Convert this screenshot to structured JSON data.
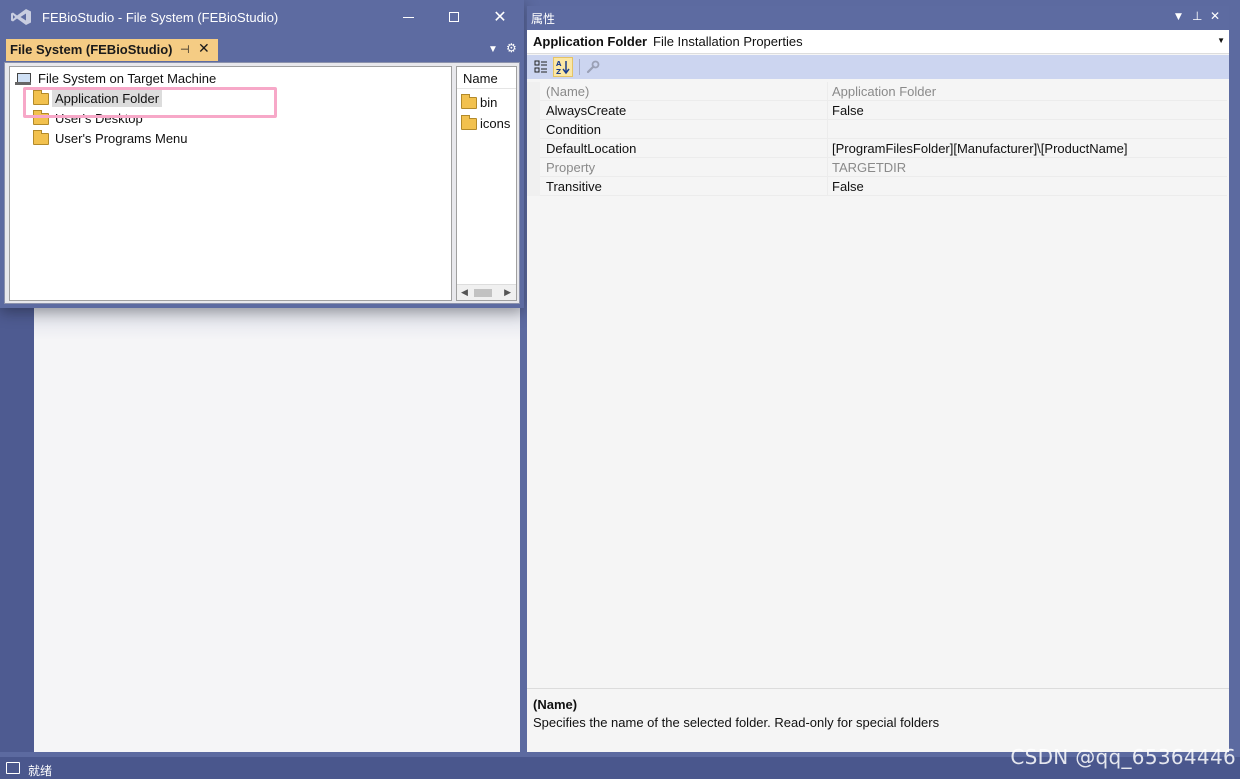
{
  "window": {
    "title": "FEBioStudio - File System (FEBioStudio)"
  },
  "doc_tab": {
    "label": "File System (FEBioStudio)",
    "pin_glyph": "⊣",
    "close_glyph": "✕"
  },
  "tree": {
    "root": "File System on Target Machine",
    "items": [
      {
        "label": "Application Folder",
        "selected": true
      },
      {
        "label": "User's Desktop",
        "selected": false
      },
      {
        "label": "User's Programs Menu",
        "selected": false
      }
    ]
  },
  "file_list": {
    "header": "Name",
    "items": [
      "bin",
      "icons"
    ]
  },
  "properties": {
    "title": "属性",
    "object_name": "Application Folder",
    "object_type": "File Installation Properties",
    "rows": [
      {
        "key": "(Name)",
        "value": "Application Folder",
        "readonly": true
      },
      {
        "key": "AlwaysCreate",
        "value": "False",
        "readonly": false
      },
      {
        "key": "Condition",
        "value": "",
        "readonly": false
      },
      {
        "key": "DefaultLocation",
        "value": "[ProgramFilesFolder][Manufacturer]\\[ProductName]",
        "readonly": false
      },
      {
        "key": "Property",
        "value": "TARGETDIR",
        "readonly": true
      },
      {
        "key": "Transitive",
        "value": "False",
        "readonly": false
      }
    ],
    "description_title": "(Name)",
    "description_text": "Specifies the name of the selected folder. Read-only for special folders"
  },
  "status_bar": {
    "text": "就绪"
  },
  "watermark": "CSDN @qq_65364446",
  "colors": {
    "chrome": "#5c6aa0",
    "active_tab": "#f5cc84",
    "highlight_box": "#f7a8c8",
    "toolbar": "#ccd5f0"
  },
  "icons": {
    "logo": "visual-studio-logo-icon",
    "root": "computer-icon",
    "folder": "folder-icon"
  }
}
